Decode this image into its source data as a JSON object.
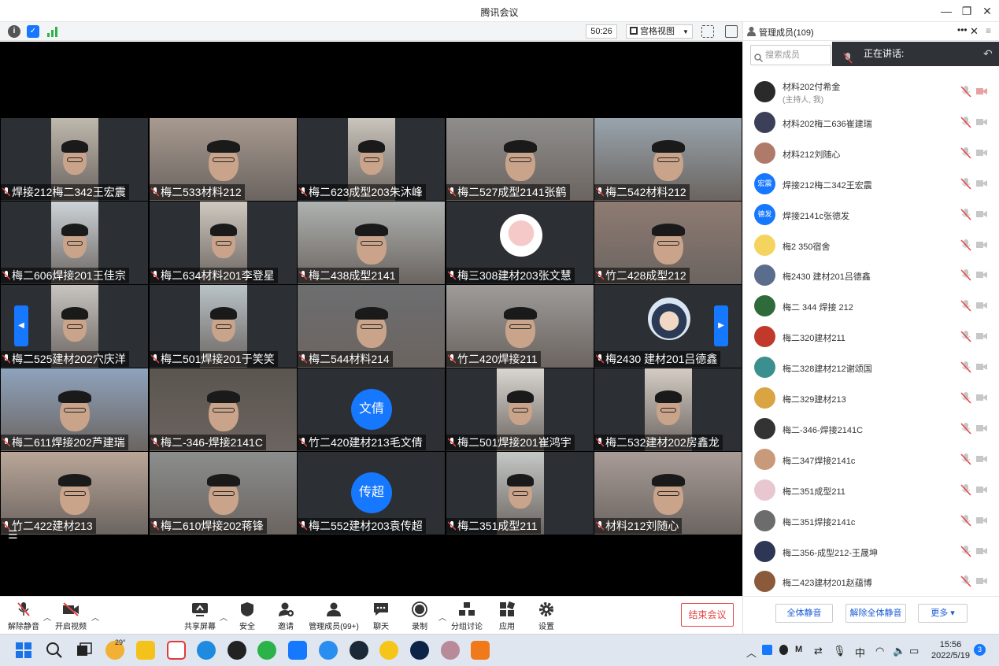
{
  "window": {
    "title": "腾讯会议",
    "minimize": "—",
    "restore": "❐",
    "close": "✕"
  },
  "infobar": {
    "timer": "50:26",
    "view_label": "宫格视图"
  },
  "tiles": [
    {
      "name": "焊接212梅二342王宏震",
      "kind": "video",
      "bg": "#bfb8ad"
    },
    {
      "name": "梅二533材料212",
      "kind": "video",
      "bg": "#a89a90"
    },
    {
      "name": "梅二623成型203朱沐峰",
      "kind": "video",
      "bg": "#c9c4bc"
    },
    {
      "name": "梅二527成型2141张鹤",
      "kind": "video",
      "bg": "#8f8e8c"
    },
    {
      "name": "梅二542材料212",
      "kind": "video",
      "bg": "#98a4ad"
    },
    {
      "name": "梅二606焊接201王佳宗",
      "kind": "video",
      "bg": "#cdd3d8"
    },
    {
      "name": "梅二634材料201李登星",
      "kind": "video",
      "bg": "#cfc9c0"
    },
    {
      "name": "梅二438成型2141",
      "kind": "video",
      "bg": "#aeb2b0"
    },
    {
      "name": "梅三308建材203张文慧",
      "kind": "image",
      "bg": "#2c2f33"
    },
    {
      "name": "竹二428成型212",
      "kind": "video",
      "bg": "#8e7b72"
    },
    {
      "name": "梅二525建材202穴庆洋",
      "kind": "video",
      "bg": "#c8c4c0"
    },
    {
      "name": "梅二501焊接201于笑笑",
      "kind": "video",
      "bg": "#b9c3c8"
    },
    {
      "name": "梅二544材料214",
      "kind": "video",
      "bg": "#6d6e70"
    },
    {
      "name": "竹二420焊接211",
      "kind": "video",
      "bg": "#9e9b98"
    },
    {
      "name": "梅2430 建材201吕德鑫",
      "kind": "image",
      "bg": "#2c2f33"
    },
    {
      "name": "梅二611焊接202芦建瑞",
      "kind": "video",
      "bg": "#8ea3bd"
    },
    {
      "name": "梅二-346-焊接2141C",
      "kind": "video",
      "bg": "#5b5550"
    },
    {
      "name": "竹二420建材213毛文倩",
      "kind": "initials",
      "initials": "文倩",
      "bg": "#2c2f33"
    },
    {
      "name": "梅二501焊接201崔鸿宇",
      "kind": "video",
      "bg": "#d9d6d1"
    },
    {
      "name": "梅二532建材202房鑫龙",
      "kind": "video",
      "bg": "#d4ccc4"
    },
    {
      "name": "竹二422建材213",
      "kind": "video",
      "bg": "#b9a698"
    },
    {
      "name": "梅二610焊接202蒋锋",
      "kind": "video",
      "bg": "#8b8e8d"
    },
    {
      "name": "梅二552建材203袁传超",
      "kind": "initials",
      "initials": "传超",
      "bg": "#2c2f33"
    },
    {
      "name": "梅二351成型211",
      "kind": "video",
      "bg": "#c4c8c6"
    },
    {
      "name": "材料212刘随心",
      "kind": "video",
      "bg": "#a89c97"
    }
  ],
  "toolbar": {
    "unmute": "解除静音",
    "start_video": "开启视频",
    "share": "共享屏幕",
    "security": "安全",
    "invite": "邀请",
    "members": "管理成员(99+)",
    "chat": "聊天",
    "record": "录制",
    "breakout": "分组讨论",
    "apps": "应用",
    "settings": "设置",
    "end": "结束会议"
  },
  "panel": {
    "title": "管理成员(109)",
    "search_placeholder": "搜索成员",
    "speaking_label": "正在讲话:",
    "members": [
      {
        "name": "材料202付希金",
        "sub": "(主持人, 我)",
        "av": "#2a2a2a",
        "initials": ""
      },
      {
        "name": "材料202梅二636崔建瑞",
        "sub": "",
        "av": "#3b3f58",
        "initials": ""
      },
      {
        "name": "材料212刘随心",
        "sub": "",
        "av": "#b07a6a",
        "initials": ""
      },
      {
        "name": "焊接212梅二342王宏震",
        "sub": "",
        "av": "#1677ff",
        "initials": "宏震"
      },
      {
        "name": "焊接2141c张德发",
        "sub": "",
        "av": "#1677ff",
        "initials": "德发"
      },
      {
        "name": "梅2 350宿舍",
        "sub": "",
        "av": "#f4d35e",
        "initials": ""
      },
      {
        "name": "梅2430 建材201吕德鑫",
        "sub": "",
        "av": "#5a6d8c",
        "initials": ""
      },
      {
        "name": "梅二 344 焊接 212",
        "sub": "",
        "av": "#2f6b3a",
        "initials": ""
      },
      {
        "name": "梅二320建材211",
        "sub": "",
        "av": "#c0392b",
        "initials": ""
      },
      {
        "name": "梅二328建材212谢颂国",
        "sub": "",
        "av": "#3b8f8f",
        "initials": ""
      },
      {
        "name": "梅二329建材213",
        "sub": "",
        "av": "#d9a441",
        "initials": ""
      },
      {
        "name": "梅二-346-焊接2141C",
        "sub": "",
        "av": "#333333",
        "initials": ""
      },
      {
        "name": "梅二347焊接2141c",
        "sub": "",
        "av": "#c99a7a",
        "initials": ""
      },
      {
        "name": "梅二351成型211",
        "sub": "",
        "av": "#e8c7d0",
        "initials": ""
      },
      {
        "name": "梅二351焊接2141c",
        "sub": "",
        "av": "#6c6c6c",
        "initials": ""
      },
      {
        "name": "梅二356-成型212-王晟坤",
        "sub": "",
        "av": "#2e3656",
        "initials": ""
      },
      {
        "name": "梅二423建材201赵蕴博",
        "sub": "",
        "av": "#8a5a3a",
        "initials": ""
      }
    ],
    "mute_all": "全体静音",
    "unmute_all": "解除全体静音",
    "more": "更多 ▾"
  },
  "taskbar": {
    "weather": "29°",
    "time": "15:56",
    "date": "2022/5/19",
    "notifications": "3",
    "ime": "中"
  }
}
